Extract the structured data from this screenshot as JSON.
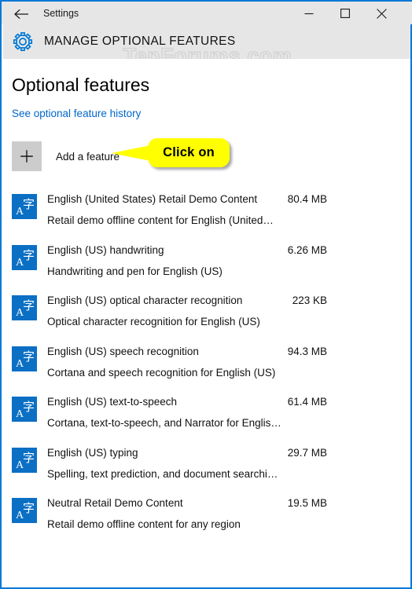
{
  "window": {
    "titlebar": {
      "back_icon": "back-arrow-icon",
      "title": "Settings",
      "minimize_label": "─",
      "maximize_label": "☐",
      "close_label": "✕"
    },
    "accent_color": "#0078d7",
    "header_bg": "#e6e6e6"
  },
  "header": {
    "icon": "gear-icon",
    "title": "MANAGE OPTIONAL FEATURES"
  },
  "watermark": {
    "text": "TenForums.com"
  },
  "main": {
    "page_title": "Optional features",
    "history_link": "See optional feature history",
    "history_link_color": "#0066cc",
    "add_feature": {
      "plus_icon": "plus-icon",
      "label": "Add a feature"
    }
  },
  "callout": {
    "text": "Click on",
    "fill_color": "#ffff00",
    "text_color": "#000000"
  },
  "features": [
    {
      "icon": "language-pack-icon",
      "name": "English (United States) Retail Demo Content",
      "size": "80.4 MB",
      "description": "Retail demo offline content for English (United…"
    },
    {
      "icon": "language-pack-icon",
      "name": "English (US) handwriting",
      "size": "6.26 MB",
      "description": "Handwriting and pen for English (US)"
    },
    {
      "icon": "language-pack-icon",
      "name": "English (US) optical character recognition",
      "size": "223 KB",
      "description": "Optical character recognition for English (US)"
    },
    {
      "icon": "language-pack-icon",
      "name": "English (US) speech recognition",
      "size": "94.3 MB",
      "description": "Cortana and speech recognition for English (US)"
    },
    {
      "icon": "language-pack-icon",
      "name": "English (US) text-to-speech",
      "size": "61.4 MB",
      "description": "Cortana, text-to-speech, and Narrator for Englis…"
    },
    {
      "icon": "language-pack-icon",
      "name": "English (US) typing",
      "size": "29.7 MB",
      "description": "Spelling, text prediction, and document searchi…"
    },
    {
      "icon": "language-pack-icon",
      "name": "Neutral Retail Demo Content",
      "size": "19.5 MB",
      "description": "Retail demo offline content for any region"
    }
  ]
}
